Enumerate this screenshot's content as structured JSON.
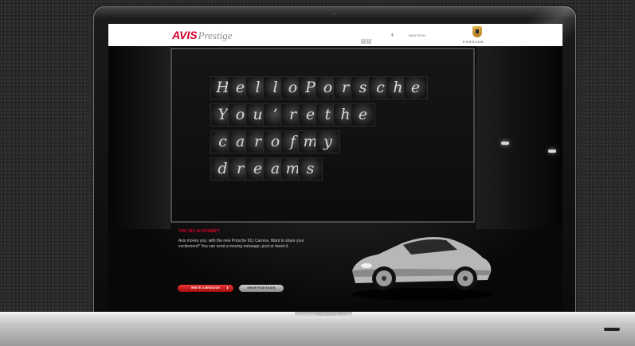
{
  "header": {
    "logo_avis": "AVIS",
    "logo_prestige": "Prestige",
    "social": [
      "f",
      "t"
    ],
    "back_arrow": "‹",
    "language": "DEUTSCH",
    "brand": "PORSCHE"
  },
  "billboard": {
    "rows": [
      [
        "H",
        "e",
        "l",
        "l",
        "o",
        "P",
        "o",
        "r",
        "s",
        "c",
        "h",
        "e"
      ],
      [
        "Y",
        "o",
        "u",
        "’",
        "r",
        "e",
        "t",
        "h",
        "e"
      ],
      [
        "c",
        "a",
        "r",
        "o",
        "f",
        "m",
        "y"
      ],
      [
        "d",
        "r",
        "e",
        "a",
        "m",
        "s"
      ]
    ]
  },
  "content": {
    "title": "THE 911 ALPHABET.",
    "body": "Avis moves you: with the new Porsche 911 Carrera. Want to share your excitement? You can send a moving message, post or tweet it.",
    "write_button": "WRITE A MESSAGE",
    "show_button": "SHOW FILM AGAIN"
  },
  "device": {
    "model": "MacBook Pro"
  },
  "colors": {
    "accent": "#e4002b",
    "page_bg": "#000000"
  }
}
